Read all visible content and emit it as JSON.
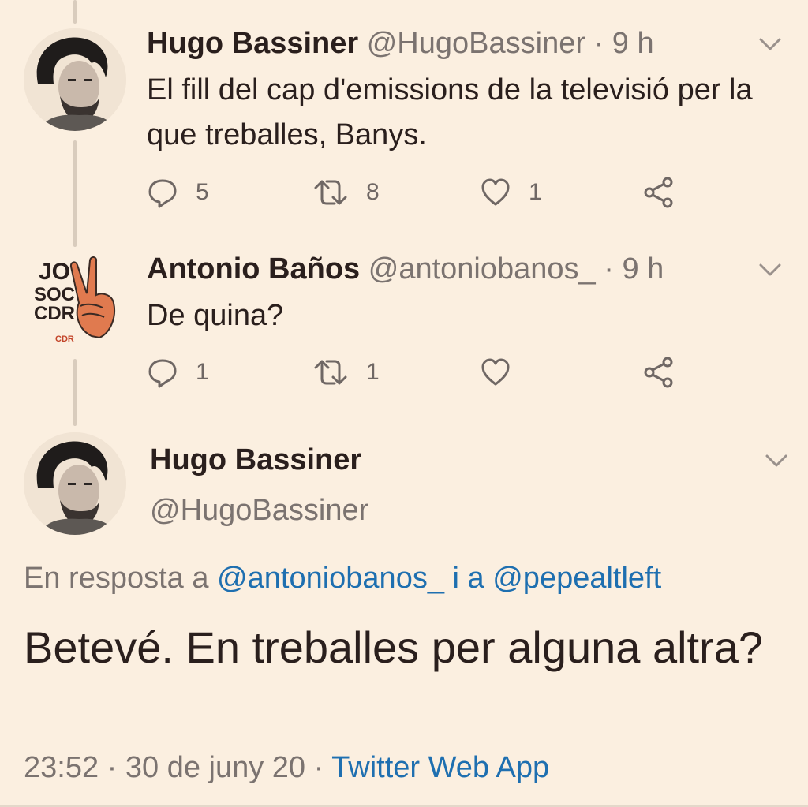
{
  "tweets": [
    {
      "name": "Hugo Bassiner",
      "handle": "@HugoBassiner",
      "separator": "·",
      "time": "9 h",
      "text": "El fill del cap d'emissions de la televisió per la que treballes, Banys.",
      "replies": "5",
      "retweets": "8",
      "likes": "1"
    },
    {
      "name": "Antonio Baños",
      "handle": "@antoniobanos_",
      "separator": "·",
      "time": "9 h",
      "text": "De quina?",
      "replies": "1",
      "retweets": "1",
      "likes": "",
      "avatar_text": [
        "JO",
        "SOC",
        "CDR",
        "CDR"
      ]
    }
  ],
  "main": {
    "name": "Hugo Bassiner",
    "handle": "@HugoBassiner",
    "reply_prefix": "En resposta a",
    "reply_user1": "@antoniobanos_",
    "reply_join": "i a",
    "reply_user2": "@pepealtleft",
    "text": "Betevé. En treballes per alguna altra?",
    "time": "23:52",
    "separator": "·",
    "date": "30 de juny 20",
    "source": "Twitter Web App"
  },
  "colors": {
    "background": "#fbefe0",
    "link": "#1e6fb0",
    "muted": "#7b7370",
    "hand": "#e07a4f"
  },
  "icons": [
    "reply-icon",
    "retweet-icon",
    "like-icon",
    "share-icon",
    "chevron-down-icon"
  ]
}
